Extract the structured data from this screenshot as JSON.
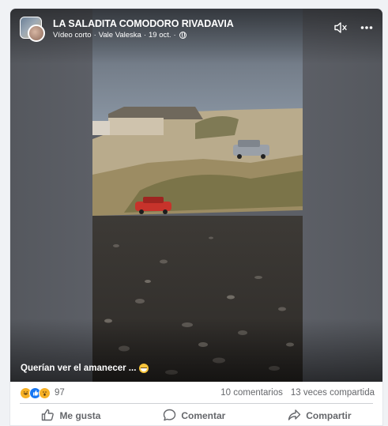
{
  "post": {
    "page_name": "LA SALADITA COMODORO RIVADAVIA",
    "meta_type": "Vídeo corto",
    "meta_author": "Vale Valeska",
    "meta_date": "19 oct.",
    "separator": "·",
    "caption": "Querían ver el amanecer ..."
  },
  "icons": {
    "mute": "speaker-muted-icon",
    "more": "more-options-icon",
    "privacy": "globe-icon",
    "caption_emoji": "grinning-emoji-icon"
  },
  "stats": {
    "reaction_icons": [
      "haha-reaction-icon",
      "like-reaction-icon",
      "wow-reaction-icon"
    ],
    "reaction_count": "97",
    "comments": "10 comentarios",
    "shares": "13 veces compartida"
  },
  "actions": {
    "like": "Me gusta",
    "comment": "Comentar",
    "share": "Compartir"
  },
  "colors": {
    "accent": "#1877f2",
    "secondary_text": "#65676b",
    "background": "#f0f2f5"
  }
}
